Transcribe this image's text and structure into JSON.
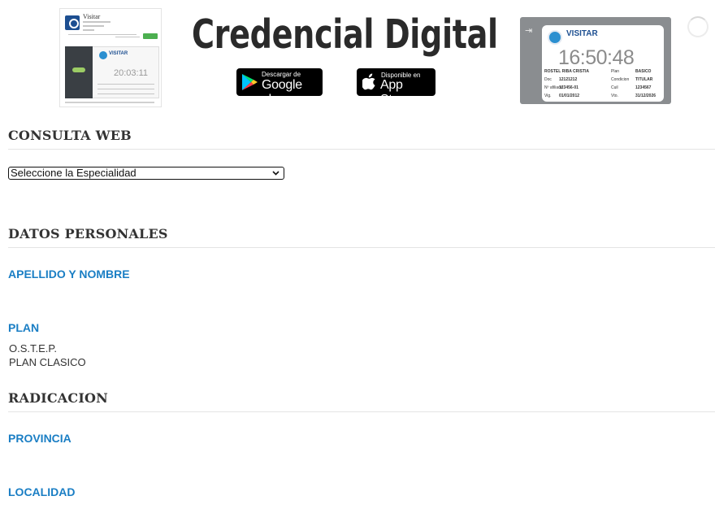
{
  "banner": {
    "title": "Credencial Digital",
    "phone_preview": {
      "app_name": "Visitar",
      "clock": "20:03:11"
    },
    "google_play": {
      "top_text": "Descargar de",
      "bottom_text": "Google play"
    },
    "app_store": {
      "top_text": "Disponible en",
      "bottom_text": "App Store"
    },
    "tablet_preview": {
      "brand": "VISITAR",
      "clock": "16:50:48",
      "rows": [
        [
          "ROSTEL RIBA CRISTIA",
          "Plan",
          "BASICO"
        ],
        [
          "Doc",
          "12121212",
          "Condicion",
          "TITULAR"
        ],
        [
          "Nº afiliado",
          "123456-01",
          "Cuil",
          "1234567"
        ],
        [
          "Vig.",
          "01/01/2012",
          "Vto.",
          "31/12/2026"
        ]
      ]
    }
  },
  "consulta_web": {
    "heading": "CONSULTA WEB",
    "select": {
      "selected": "Seleccione la Especialidad"
    }
  },
  "datos_personales": {
    "heading": "DATOS PERSONALES",
    "apellido_label": "APELLIDO Y NOMBRE",
    "plan_label": "PLAN",
    "plan_line_1": "O.S.T.E.P.",
    "plan_line_2": "PLAN CLASICO"
  },
  "radicacion": {
    "heading": "RADICACION",
    "provincia_label": "PROVINCIA",
    "localidad_label": "LOCALIDAD"
  },
  "colors": {
    "label_blue": "#1a7ec4",
    "heading_text": "#333333",
    "brand_blue": "#1d4f91"
  }
}
